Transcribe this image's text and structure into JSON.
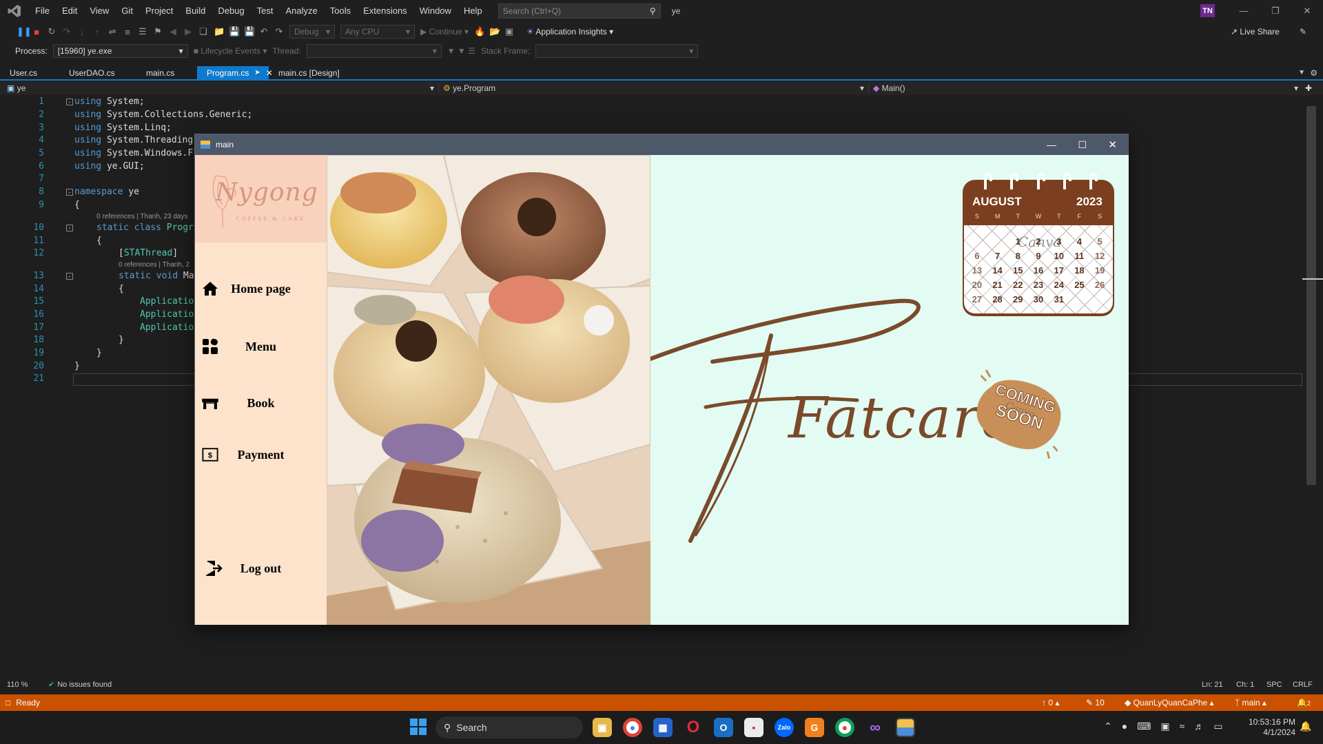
{
  "vs": {
    "menu": [
      "File",
      "Edit",
      "View",
      "Git",
      "Project",
      "Build",
      "Debug",
      "Test",
      "Analyze",
      "Tools",
      "Extensions",
      "Window",
      "Help"
    ],
    "search_placeholder": "Search (Ctrl+Q)",
    "solution_name": "ye",
    "user_initials": "TN",
    "toolbar": {
      "config": "Debug",
      "platform": "Any CPU",
      "continue": "Continue",
      "app_insights": "Application Insights",
      "live_share": "Live Share"
    },
    "debug_bar": {
      "process_label": "Process:",
      "process_value": "[15960] ye.exe",
      "lifecycle": "Lifecycle Events",
      "thread_label": "Thread:",
      "stack_label": "Stack Frame:"
    },
    "tabs": [
      "User.cs",
      "UserDAO.cs",
      "main.cs",
      "Program.cs",
      "main.cs [Design]"
    ],
    "active_tab": "Program.cs",
    "nav": {
      "project": "ye",
      "class": "ye.Program",
      "member": "Main()"
    },
    "code": {
      "line_numbers": [
        "1",
        "2",
        "3",
        "4",
        "5",
        "6",
        "7",
        "8",
        "9",
        "10",
        "11",
        "12",
        "13",
        "14",
        "15",
        "16",
        "17",
        "18",
        "19",
        "20",
        "21"
      ],
      "l1_kw": "using",
      "l1_rest": " System;",
      "l2_kw": "using",
      "l2_rest": " System.Collections.Generic;",
      "l3_kw": "using",
      "l3_rest": " System.Linq;",
      "l4_kw": "using",
      "l4_rest": " System.Threading",
      "l5_kw": "using",
      "l5_rest": " System.Windows.F",
      "l6_kw": "using",
      "l6_rest": " ye.GUI;",
      "l8_kw": "namespace",
      "l8_rest": " ye",
      "l9": "{",
      "ref1": "0 references | Thanh, 23 days",
      "l10_kw": "static class",
      "l10_cls": " Progr",
      "l11": "{",
      "l12_open": "[",
      "l12_attr": "STAThread",
      "l12_close": "]",
      "ref2": "0 references | Thanh, 2",
      "l13_kw": "static void",
      "l13_rest": " Ma",
      "l14": "{",
      "l15": "Applicatio",
      "l16": "Applicatio",
      "l17": "Applicatio",
      "l18": "}",
      "l19": "}",
      "l20": "}"
    },
    "editor_status": {
      "zoom": "110 %",
      "issues": "No issues found",
      "ln": "Ln: 21",
      "ch": "Ch: 1",
      "spc": "SPC",
      "crlf": "CRLF"
    },
    "status": {
      "ready": "Ready",
      "up": "0",
      "edits": "10",
      "repo": "QuanLyQuanCaPhe",
      "branch": "main",
      "notif": "2"
    }
  },
  "form": {
    "title": "main",
    "logo_script": "Nygong",
    "logo_sub": "COFFEE & CAKE",
    "nav": [
      {
        "label": "Home page",
        "icon": "home-icon"
      },
      {
        "label": "Menu",
        "icon": "grid-icon"
      },
      {
        "label": "Book",
        "icon": "table-icon"
      },
      {
        "label": "Payment",
        "icon": "bill-icon"
      }
    ],
    "logout": "Log out",
    "brand": "Fatcaron",
    "calendar": {
      "month": "AUGUST",
      "year": "2023",
      "weekdays": [
        "S",
        "M",
        "T",
        "W",
        "T",
        "F",
        "S"
      ],
      "rows": [
        [
          "",
          "",
          "1",
          "2",
          "3",
          "4",
          "5"
        ],
        [
          "6",
          "7",
          "8",
          "9",
          "10",
          "11",
          "12"
        ],
        [
          "13",
          "14",
          "15",
          "16",
          "17",
          "18",
          "19"
        ],
        [
          "20",
          "21",
          "22",
          "23",
          "24",
          "25",
          "26"
        ],
        [
          "27",
          "28",
          "29",
          "30",
          "31",
          "",
          ""
        ]
      ],
      "watermark": "Canva"
    },
    "badge_line1": "COMING",
    "badge_line2": "SOON",
    "badge_watermark": "Canva",
    "colors": {
      "sidebar": "#fde3cc",
      "logo_bg": "#f8d2bd",
      "content": "#e2fbf3",
      "brand": "#7a4a2a",
      "calendar_head": "#7b3f1f"
    }
  },
  "taskbar": {
    "search": "Search",
    "time": "10:53:16 PM",
    "date": "4/1/2024"
  }
}
